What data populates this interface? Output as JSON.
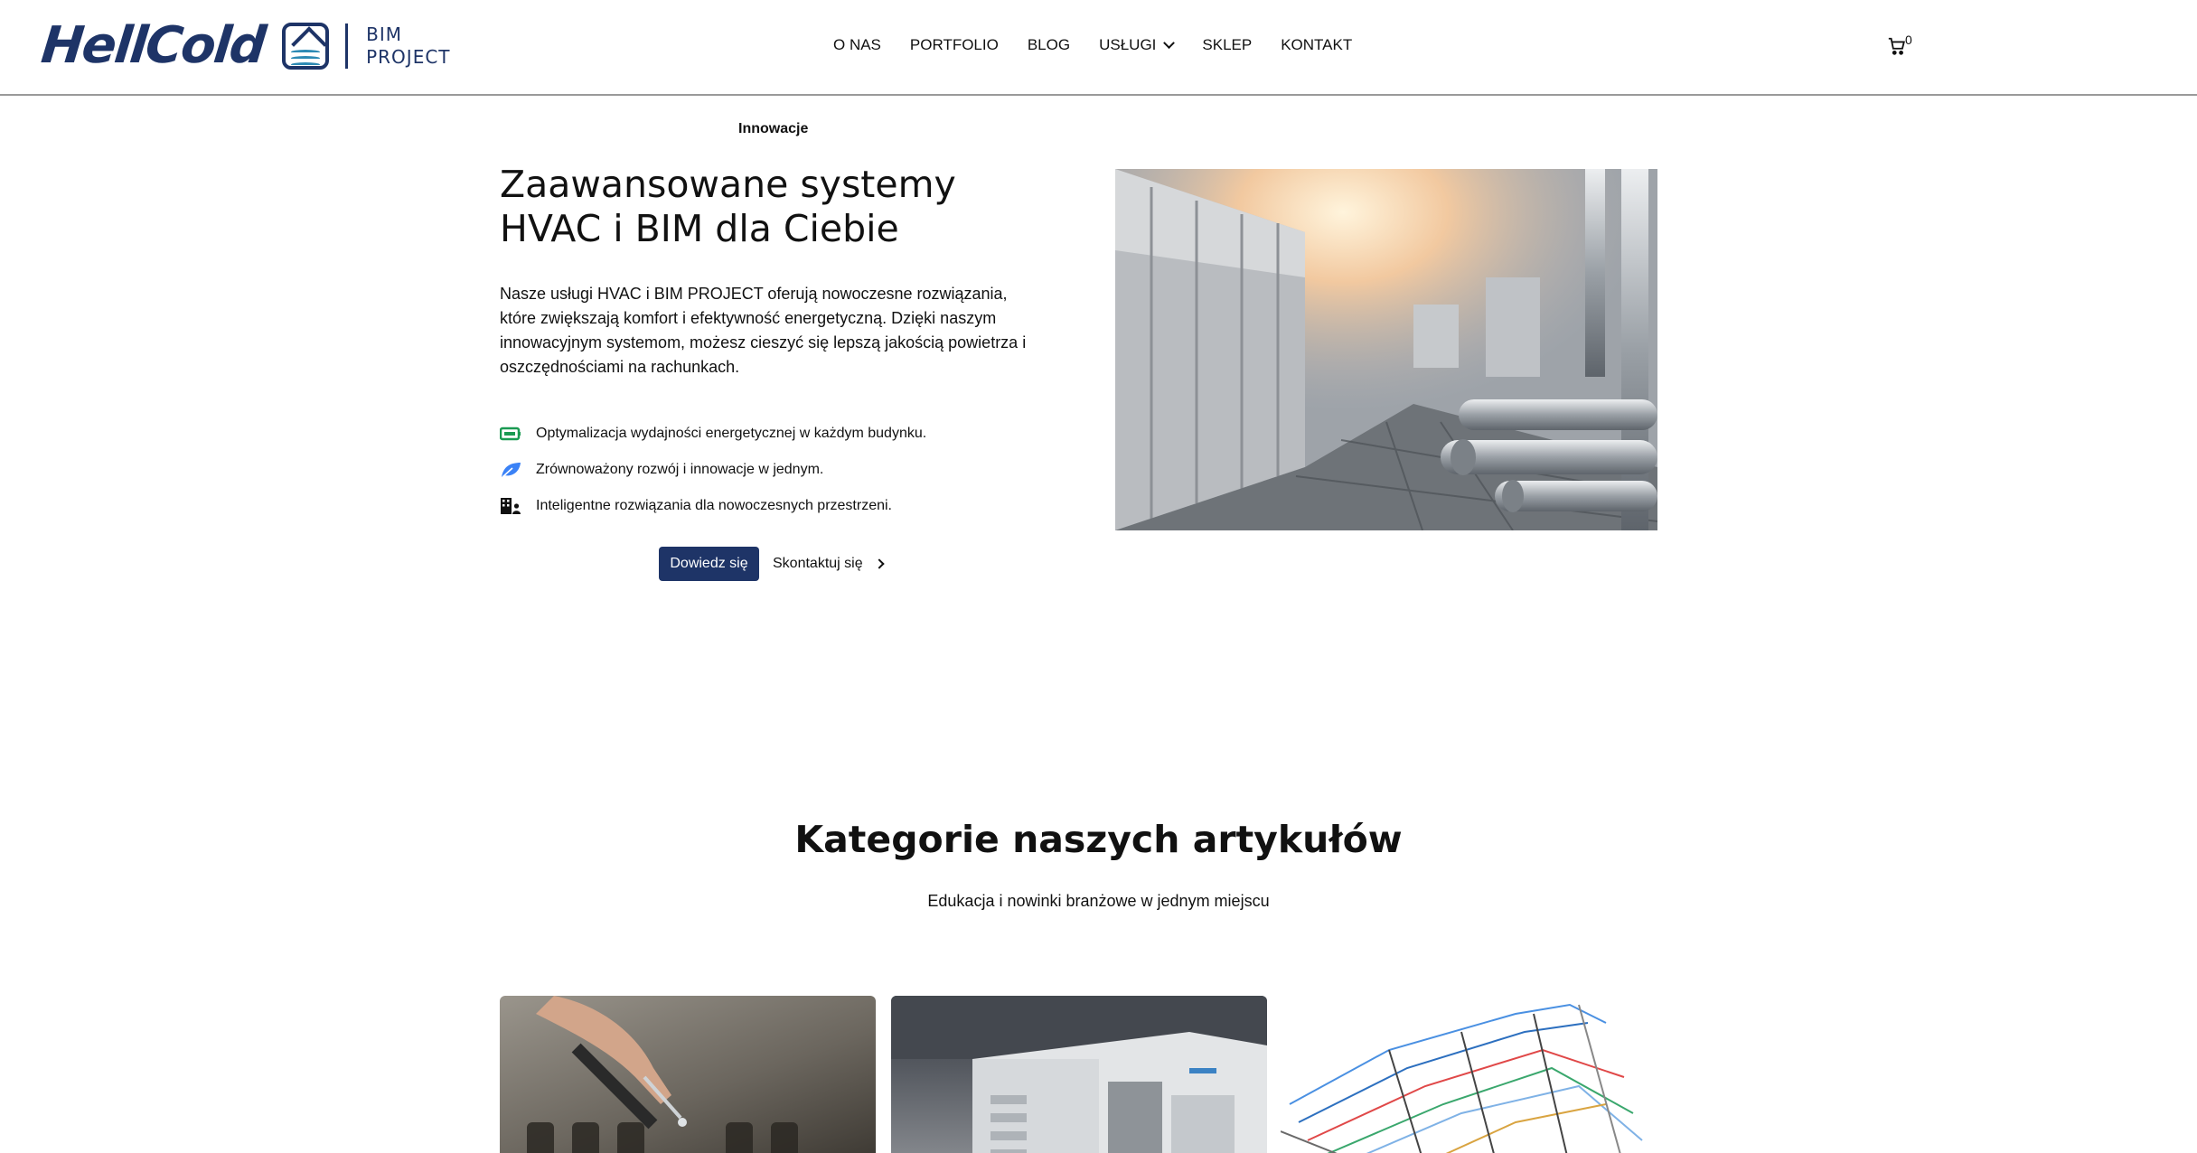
{
  "brand": {
    "logo_word": "HellCold",
    "logo_sub_line1": "BIM",
    "logo_sub_line2": "PROJECT",
    "primary_color": "#1e3467"
  },
  "nav": {
    "items": [
      "O NAS",
      "PORTFOLIO",
      "BLOG",
      "USŁUGI",
      "SKLEP",
      "KONTAKT"
    ],
    "cart_count": "0"
  },
  "hero": {
    "tagline": "Innowacje",
    "title": "Zaawansowane systemy HVAC i BIM dla Ciebie",
    "text": "Nasze usługi HVAC i BIM PROJECT oferują nowoczesne rozwiązania, które zwiększają komfort i efektywność energetyczną. Dzięki naszym innowacyjnym systemom, możesz cieszyć się lepszą jakością powietrza i oszczędnościami na rachunkach.",
    "features": [
      {
        "icon": "battery-icon",
        "text": "Optymalizacja wydajności energetycznej w każdym budynku."
      },
      {
        "icon": "leaf-icon",
        "text": "Zrównoważony rozwój i innowacje w jednym."
      },
      {
        "icon": "building-user-icon",
        "text": "Inteligentne rozwiązania dla nowoczesnych przestrzeni."
      }
    ],
    "primary_button": "Dowiedz się",
    "secondary_button": "Skontaktuj się"
  },
  "categories": {
    "title": "Kategorie naszych artykułów",
    "subtitle": "Edukacja i nowinki branżowe w jednym miejscu"
  }
}
